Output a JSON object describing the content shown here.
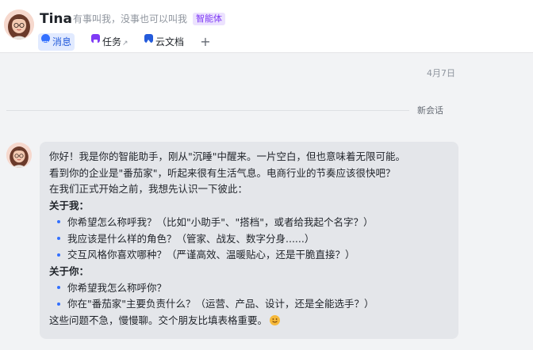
{
  "header": {
    "title": "Tina",
    "subtitle": "有事叫我，没事也可以叫我",
    "badge": "智能体"
  },
  "tabs": [
    {
      "label": "消息",
      "active": true,
      "icon": "chat-icon",
      "color": "#3370ff"
    },
    {
      "label": "任务",
      "active": false,
      "icon": "task-icon",
      "color": "#7f3bf5",
      "external": "↗"
    },
    {
      "label": "云文档",
      "active": false,
      "icon": "doc-icon",
      "color": "#245bdb"
    }
  ],
  "add_tab": "+",
  "date": "4月7日",
  "divider": "新会话",
  "message": {
    "intro": [
      "你好！我是你的智能助手，刚从\"沉睡\"中醒来。一片空白，但也意味着无限可能。",
      "看到你的企业是\"番茄家\"，听起来很有生活气息。电商行业的节奏应该很快吧？",
      "在我们正式开始之前，我想先认识一下彼此："
    ],
    "section1_title": "关于我：",
    "section1_items": [
      "你希望怎么称呼我？（比如\"小助手\"、\"搭档\"，或者给我起个名字？）",
      "我应该是什么样的角色？（管家、战友、数字分身......）",
      "交互风格你喜欢哪种？（严谨高效、温暖贴心，还是干脆直接？）"
    ],
    "section2_title": "关于你：",
    "section2_items": [
      "你希望我怎么称呼你？",
      "你在\"番茄家\"主要负责什么？（运营、产品、设计，还是全能选手？）"
    ],
    "closing": "这些问题不急，慢慢聊。交个朋友比填表格重要。",
    "emoji": "smile-emoji"
  }
}
